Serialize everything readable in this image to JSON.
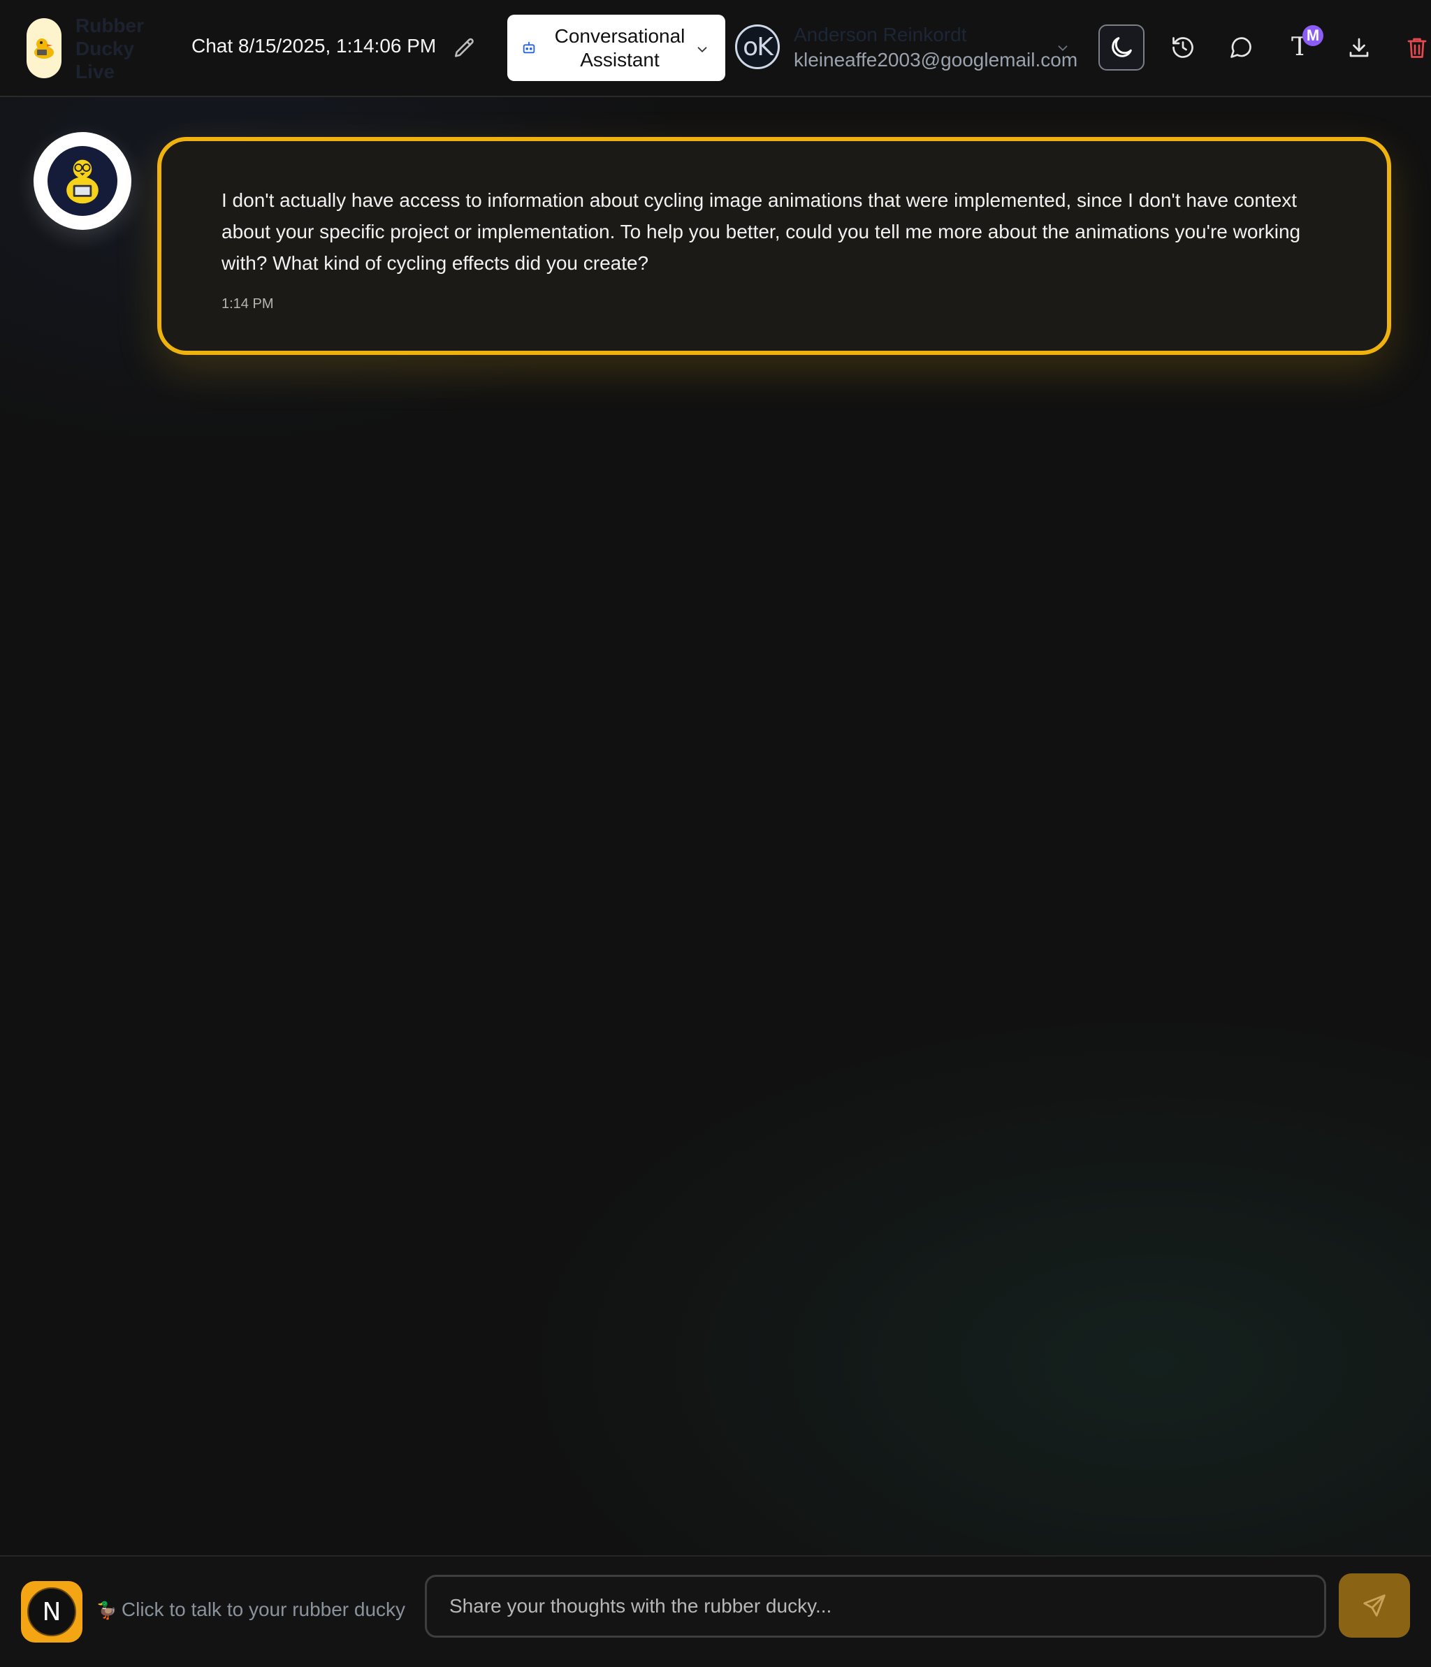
{
  "app": {
    "brand": "Rubber Ducky Live"
  },
  "header": {
    "chat_title": "Chat 8/15/2025, 1:14:06 PM",
    "assistant_select": {
      "selected": "Conversational Assistant"
    },
    "user": {
      "avatar_initials": "oK",
      "name": "Anderson Reinkordt",
      "email": "kleineaffe2003@googlemail.com"
    },
    "font_button_label": "T",
    "font_badge": "M"
  },
  "messages": [
    {
      "role": "assistant",
      "text": "I don't actually have access to information about cycling image animations that were implemented, since I don't have context about your specific project or implementation. To help you better, could you tell me more about the animations you're working with? What kind of cycling effects did you create?",
      "time": "1:14 PM"
    }
  ],
  "footer": {
    "mic_label": "N",
    "talk_hint": "Click to talk to your rubber ducky",
    "input_placeholder": "Share your thoughts with the rubber ducky...",
    "input_value": ""
  },
  "colors": {
    "accent": "#f0b20e",
    "background": "#111111",
    "delete": "#e5484d",
    "badge": "#8b5cf6"
  },
  "icons": [
    "duck-logo-icon",
    "pencil-icon",
    "bot-icon",
    "chevron-down-icon",
    "moon-icon",
    "history-icon",
    "chat-bubble-icon",
    "type-icon",
    "download-icon",
    "trash-icon",
    "duck-avatar-icon",
    "duck-emoji-icon",
    "send-icon"
  ]
}
